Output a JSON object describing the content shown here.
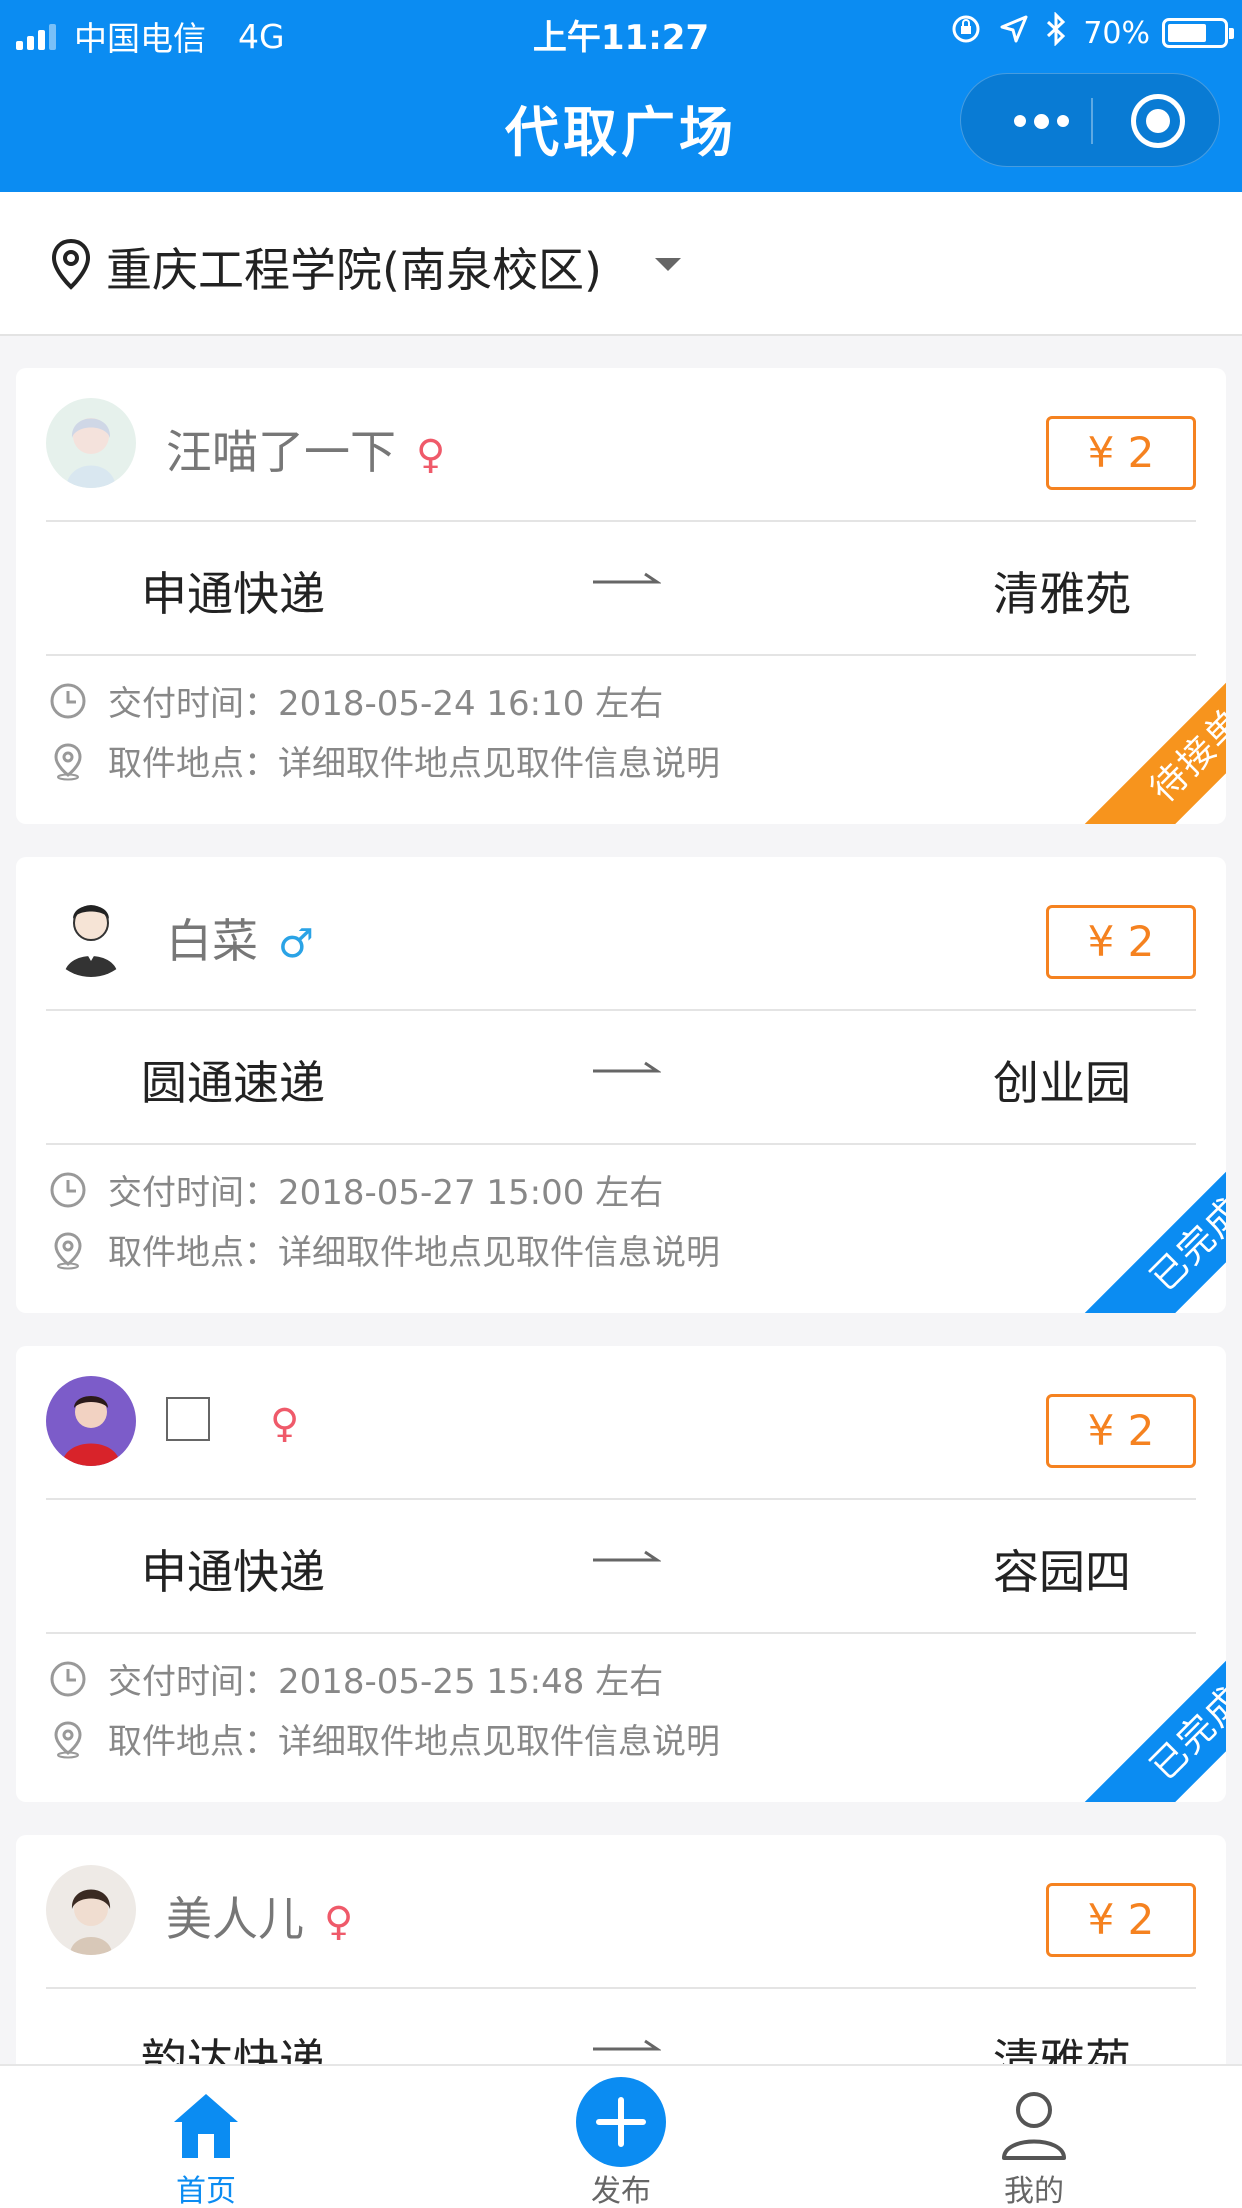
{
  "status": {
    "carrier": "中国电信",
    "network": "4G",
    "time": "上午11:27",
    "battery_percent": "70%",
    "battery_level": 0.7
  },
  "nav": {
    "title": "代取广场"
  },
  "location": {
    "campus": "重庆工程学院(南泉校区)"
  },
  "labels": {
    "deliver_time_prefix": "交付时间：",
    "pickup_place_prefix": "取件地点：",
    "approx_suffix": "左右"
  },
  "orders": [
    {
      "user": "汪喵了一下",
      "gender": "♀",
      "price": "¥ 2",
      "from": "申通快递",
      "to": "清雅苑",
      "deliver_time": "交付时间：2018-05-24 16:10 左右",
      "pickup_place": "取件地点：详细取件地点见取件信息说明",
      "status": "待接单"
    },
    {
      "user": "白菜",
      "gender": "♂",
      "price": "¥ 2",
      "from": "圆通速递",
      "to": "创业园",
      "deliver_time": "交付时间：2018-05-27 15:00 左右",
      "pickup_place": "取件地点：详细取件地点见取件信息说明",
      "status": "已完成"
    },
    {
      "user": "",
      "gender": "♀",
      "price": "¥ 2",
      "from": "申通快递",
      "to": "容园四",
      "deliver_time": "交付时间：2018-05-25 15:48 左右",
      "pickup_place": "取件地点：详细取件地点见取件信息说明",
      "status": "已完成"
    },
    {
      "user": "美人儿",
      "gender": "♀",
      "price": "¥ 2",
      "from": "韵达快递",
      "to": "清雅苑"
    }
  ],
  "tabbar": [
    {
      "label": "首页",
      "active": true
    },
    {
      "label": "发布",
      "active": false
    },
    {
      "label": "我的",
      "active": false
    }
  ],
  "colors": {
    "primary": "#0b8cf2",
    "price": "#f58220",
    "pending": "#f7941d",
    "female": "#ef5a6a",
    "male": "#2aa3e6"
  },
  "icons": [
    "signal-icon",
    "rotation-lock-icon",
    "location-arrow-icon",
    "bluetooth-icon",
    "battery-icon",
    "more-dots-icon",
    "close-target-icon",
    "location-pin-icon",
    "dropdown-caret-icon",
    "clock-icon",
    "pin-outline-icon",
    "arrow-right-icon",
    "home-icon",
    "plus-icon",
    "user-icon"
  ]
}
